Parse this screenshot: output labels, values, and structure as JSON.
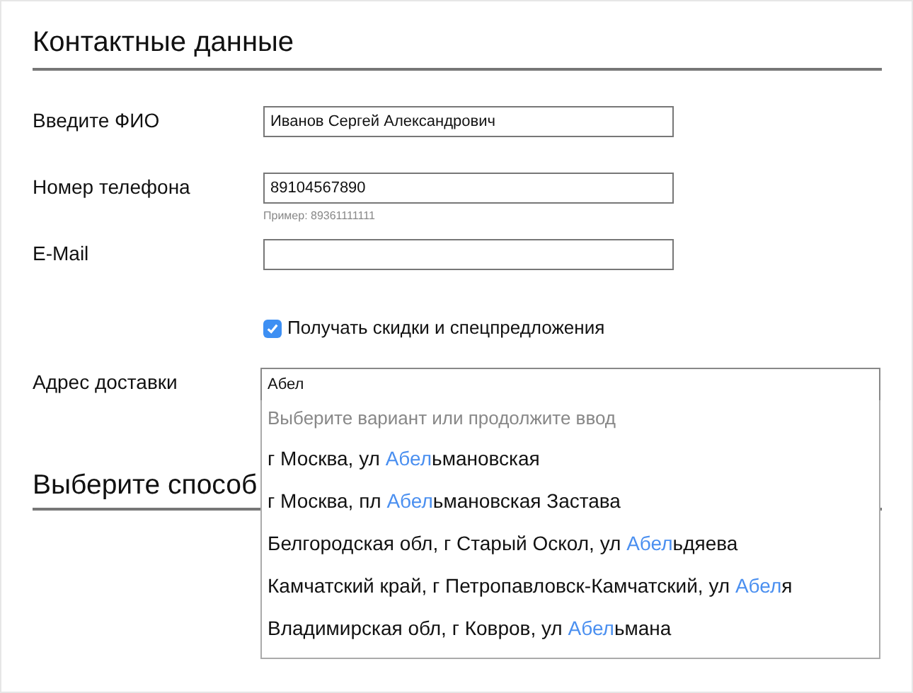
{
  "contact_section": {
    "title": "Контактные данные"
  },
  "fields": [
    {
      "label": "Введите ФИО",
      "value": "Иванов Сергей Александрович"
    },
    {
      "label": "Номер телефона",
      "value": "89104567890",
      "hint": "Пример: 89361111111"
    },
    {
      "label": "E-Mail"
    }
  ],
  "subscribe": {
    "label": "Получать скидки и спецпредложения",
    "checked": true
  },
  "address": {
    "label": "Адрес доставки",
    "value": "Абел"
  },
  "suggestions": {
    "hint": "Выберите вариант или продолжите ввод",
    "items": [
      {
        "before": "г Москва, ул ",
        "match": "Абел",
        "after": "ьмановская"
      },
      {
        "before": "г Москва, пл ",
        "match": "Абел",
        "after": "ьмановская Застава"
      },
      {
        "before": "Белгородская обл, г Старый Оскол, ул ",
        "match": "Абел",
        "after": "ьдяева"
      },
      {
        "before": "Камчатский край, г Петропавловск-Камчатский, ул ",
        "match": "Абел",
        "after": "я"
      },
      {
        "before": "Владимирская обл, г Ковров, ул ",
        "match": "Абел",
        "after": "ьмана"
      }
    ]
  },
  "delivery_section": {
    "title": "Выберите способ"
  }
}
